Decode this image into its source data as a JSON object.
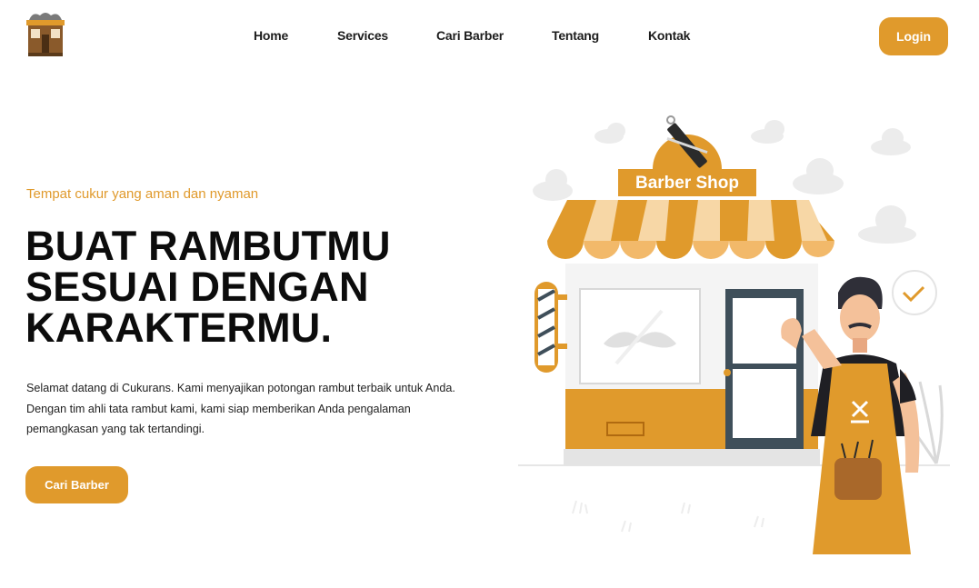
{
  "nav": {
    "links": [
      "Home",
      "Services",
      "Cari Barber",
      "Tentang",
      "Kontak"
    ],
    "login_label": "Login"
  },
  "hero": {
    "tagline": "Tempat cukur yang aman dan nyaman",
    "title_lines": [
      "BUAT RAMBUTMU",
      "SESUAI DENGAN",
      "KARAKTERMU."
    ],
    "description": "Selamat datang di Cukurans. Kami menyajikan potongan rambut terbaik untuk Anda. Dengan tim ahli tata rambut kami, kami siap memberikan Anda pengalaman pemangkasan yang tak tertandingi.",
    "cta_label": "Cari Barber"
  },
  "illustration": {
    "sign_text": "Barber Shop"
  },
  "colors": {
    "accent": "#e09a2c",
    "text_dark": "#0c0c0c"
  }
}
